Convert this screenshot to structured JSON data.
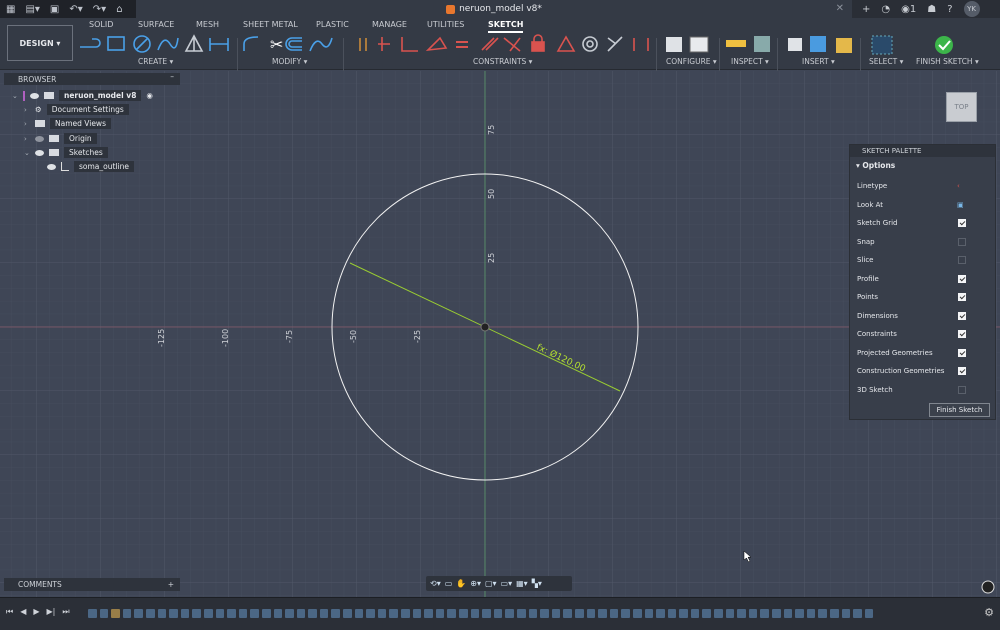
{
  "title": "neruon_model v8*",
  "quick_access": {
    "avatar": "YK",
    "notifications": "1"
  },
  "workspace": "DESIGN",
  "tabs": [
    "SOLID",
    "SURFACE",
    "MESH",
    "SHEET METAL",
    "PLASTIC",
    "MANAGE",
    "UTILITIES",
    "SKETCH"
  ],
  "active_tab": "SKETCH",
  "groups": [
    "CREATE",
    "MODIFY",
    "CONSTRAINTS",
    "CONFIGURE",
    "INSPECT",
    "INSERT",
    "SELECT",
    "FINISH SKETCH"
  ],
  "browser": {
    "title": "BROWSER",
    "root": "neruon_model v8",
    "items": [
      "Document Settings",
      "Named Views",
      "Origin",
      "Sketches"
    ],
    "sketch": "soma_outline"
  },
  "palette": {
    "title": "SKETCH PALETTE",
    "section": "Options",
    "rows": [
      {
        "label": "Linetype"
      },
      {
        "label": "Look At"
      },
      {
        "label": "Sketch Grid",
        "checked": true
      },
      {
        "label": "Snap",
        "checked": false
      },
      {
        "label": "Slice",
        "checked": false
      },
      {
        "label": "Profile",
        "checked": true
      },
      {
        "label": "Points",
        "checked": true
      },
      {
        "label": "Dimensions",
        "checked": true
      },
      {
        "label": "Constraints",
        "checked": true
      },
      {
        "label": "Projected Geometries",
        "checked": true
      },
      {
        "label": "Construction Geometries",
        "checked": true
      },
      {
        "label": "3D Sketch",
        "checked": false
      }
    ],
    "finish": "Finish Sketch"
  },
  "canvas": {
    "x_ticks": [
      "-125",
      "-100",
      "-75",
      "-50",
      "-25"
    ],
    "y_ticks": [
      "75",
      "50",
      "25"
    ],
    "dimension": "fx: Ø120.00",
    "viewcube": "TOP"
  },
  "comments": "COMMENTS",
  "colors": {
    "accent": "#9acd32",
    "background": "#3f4656"
  }
}
